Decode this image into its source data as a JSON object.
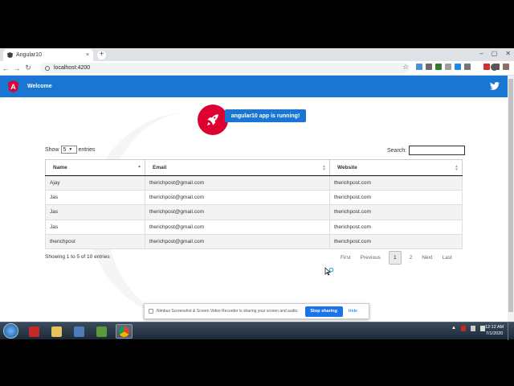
{
  "browser": {
    "tab_title": "Angular10",
    "tab_close": "×",
    "new_tab": "+",
    "url": "localhost:4200",
    "window_controls": [
      "–",
      "▢",
      "✕"
    ]
  },
  "app": {
    "welcome": "Welcome",
    "running_badge": "angular10 app is running!",
    "angular_letter": "A",
    "brand_color": "#1976d2",
    "accent_color": "#dd0031"
  },
  "table_controls": {
    "show_label": "Show",
    "entries_value": "5",
    "entries_label": "entries",
    "search_label": "Search:"
  },
  "table": {
    "columns": [
      "Name",
      "Email",
      "Website"
    ],
    "rows": [
      [
        "Ajay",
        "therichpost@gmail.com",
        "therichpost.com"
      ],
      [
        "Jas",
        "therichpost@gmail.com",
        "therichpost.com"
      ],
      [
        "Jas",
        "therichpost@gmail.com",
        "therichpost.com"
      ],
      [
        "Jas",
        "therichpost@gmail.com",
        "therichpost.com"
      ],
      [
        "therichpost",
        "therichpost@gmail.com",
        "therichpost.com"
      ]
    ]
  },
  "footer": {
    "info": "Showing 1 to 5 of 10 entries",
    "first": "First",
    "previous": "Previous",
    "page1": "1",
    "page2": "2",
    "next": "Next",
    "last": "Last"
  },
  "share_bar": {
    "message": "Nimbus Screenshot & Screen Video Recorder is sharing your screen and audio.",
    "stop": "Stop sharing",
    "hide": "Hide"
  },
  "taskbar": {
    "time": "12:12 AM",
    "date": "7/1/2020"
  }
}
